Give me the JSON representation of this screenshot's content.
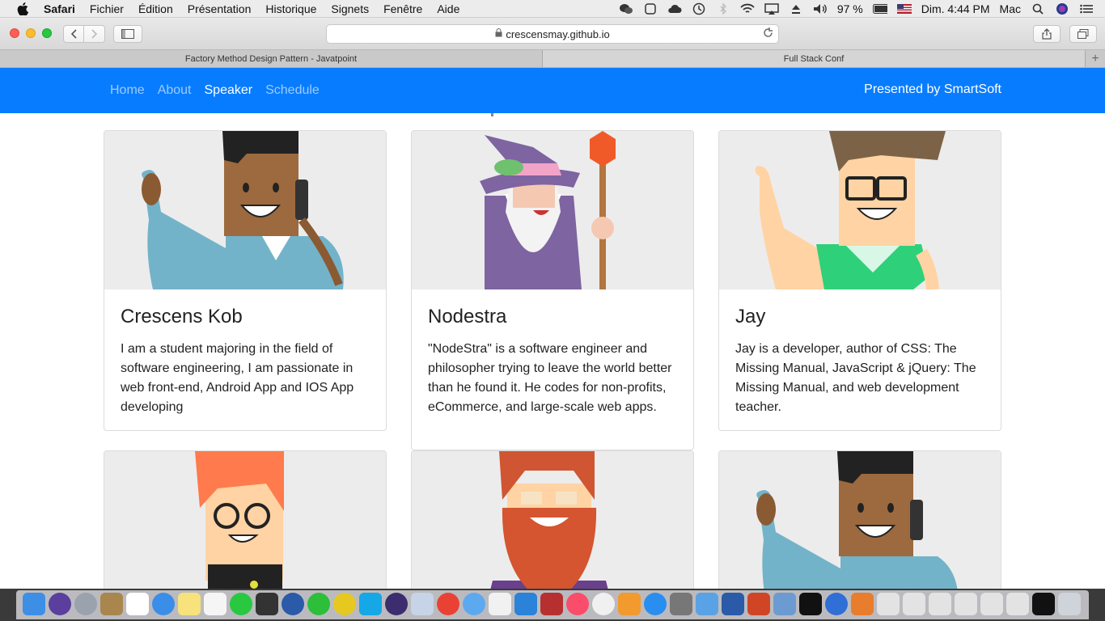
{
  "menubar": {
    "app": "Safari",
    "items": [
      "Fichier",
      "Édition",
      "Présentation",
      "Historique",
      "Signets",
      "Fenêtre",
      "Aide"
    ],
    "battery": "97 %",
    "clock": "Dim. 4:44 PM",
    "user": "Mac"
  },
  "browser": {
    "url": "crescensmay.github.io",
    "tabs": [
      "Factory Method Design Pattern - Javatpoint",
      "Full Stack Conf"
    ]
  },
  "site": {
    "nav": [
      "Home",
      "About",
      "Speaker",
      "Schedule"
    ],
    "active": "Speaker",
    "brand": "Presented by SmartSoft"
  },
  "speakers": [
    {
      "name": "Crescens Kob",
      "bio": "I am a student majoring in the field of software engineering, I am passionate in web front-end, Android App and IOS App developing"
    },
    {
      "name": "Nodestra",
      "bio": "\"NodeStra\" is a software engineer and philosopher trying to leave the world better than he found it. He codes for non-profits, eCommerce, and large-scale web apps."
    },
    {
      "name": "Jay",
      "bio": "Jay is a developer, author of CSS: The Missing Manual, JavaScript & jQuery: The Missing Manual, and web development teacher."
    }
  ],
  "colors": {
    "nav_bg": "#087cff",
    "card_img_bg": "#ececec"
  }
}
